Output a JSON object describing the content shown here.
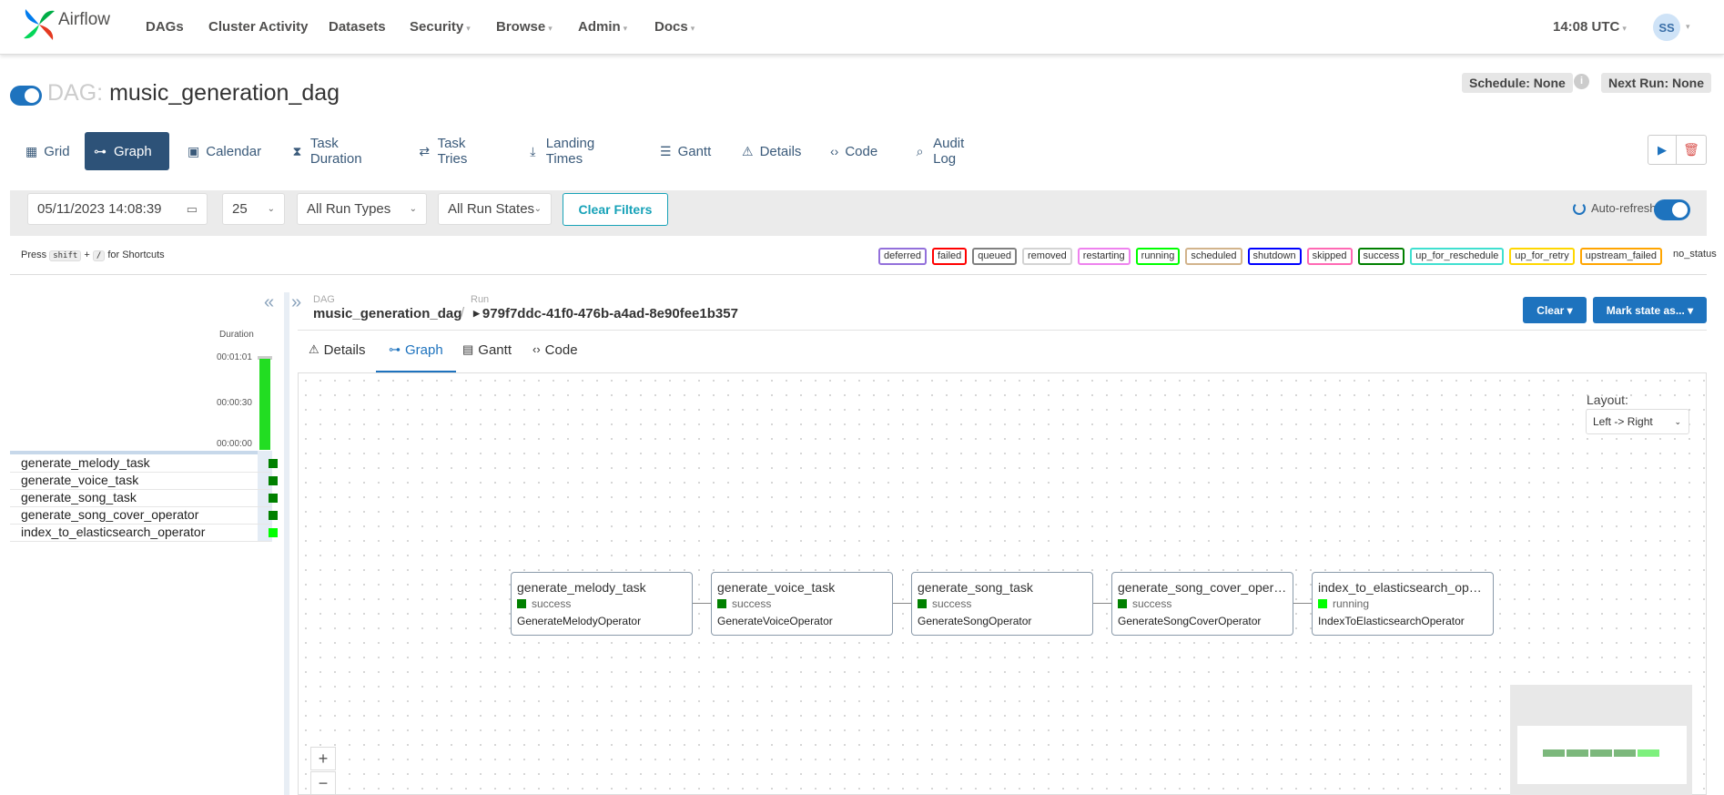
{
  "brand": {
    "name": "Airflow"
  },
  "nav": {
    "items": [
      {
        "label": "DAGs",
        "caret": false
      },
      {
        "label": "Cluster Activity",
        "caret": false
      },
      {
        "label": "Datasets",
        "caret": false
      },
      {
        "label": "Security",
        "caret": true
      },
      {
        "label": "Browse",
        "caret": true
      },
      {
        "label": "Admin",
        "caret": true
      },
      {
        "label": "Docs",
        "caret": true
      }
    ],
    "clock": "14:08 UTC",
    "avatar": "SS"
  },
  "dag": {
    "label": "DAG:",
    "name": "music_generation_dag",
    "schedule": "Schedule: None",
    "next_run": "Next Run: None",
    "paused": false
  },
  "tabs": [
    {
      "label": "Grid",
      "icon": "grid-icon",
      "glyph": "▦",
      "active": false
    },
    {
      "label": "Graph",
      "icon": "graph-icon",
      "glyph": "⊶",
      "active": true
    },
    {
      "label": "Calendar",
      "icon": "calendar-icon",
      "glyph": "▣",
      "active": false
    },
    {
      "label": "Task Duration",
      "icon": "hourglass-icon",
      "glyph": "⧗",
      "active": false
    },
    {
      "label": "Task Tries",
      "icon": "retry-icon",
      "glyph": "⇄",
      "active": false
    },
    {
      "label": "Landing Times",
      "icon": "landing-icon",
      "glyph": "⤓",
      "active": false
    },
    {
      "label": "Gantt",
      "icon": "gantt-icon",
      "glyph": "☰",
      "active": false
    },
    {
      "label": "Details",
      "icon": "warning-icon",
      "glyph": "⚠",
      "active": false
    },
    {
      "label": "Code",
      "icon": "code-icon",
      "glyph": "‹›",
      "active": false
    },
    {
      "label": "Audit Log",
      "icon": "audit-log-icon",
      "glyph": "⌕",
      "active": false
    }
  ],
  "filters": {
    "date": "05/11/2023 14:08:39",
    "num_runs": "25",
    "run_type": "All Run Types",
    "run_state": "All Run States",
    "clear_label": "Clear Filters",
    "auto_refresh_label": "Auto-refresh",
    "auto_refresh_on": true
  },
  "shortcuts": {
    "press": "Press",
    "key1": "shift",
    "plus": "+",
    "key2": "/",
    "suffix": "for Shortcuts"
  },
  "legend": [
    {
      "label": "deferred",
      "color": "#9370db"
    },
    {
      "label": "failed",
      "color": "#ff0000"
    },
    {
      "label": "queued",
      "color": "#808080"
    },
    {
      "label": "removed",
      "color": "#d3d3d3"
    },
    {
      "label": "restarting",
      "color": "#ee82ee"
    },
    {
      "label": "running",
      "color": "#00ff00"
    },
    {
      "label": "scheduled",
      "color": "#d2b48c"
    },
    {
      "label": "shutdown",
      "color": "#0000ff"
    },
    {
      "label": "skipped",
      "color": "#ff69b4"
    },
    {
      "label": "success",
      "color": "#008000"
    },
    {
      "label": "up_for_reschedule",
      "color": "#40e0d0"
    },
    {
      "label": "up_for_retry",
      "color": "#ffd700"
    },
    {
      "label": "upstream_failed",
      "color": "#ffa500"
    },
    {
      "label": "no_status",
      "color": ""
    }
  ],
  "grid": {
    "duration_label": "Duration",
    "ticks": [
      "00:01:01",
      "00:00:30",
      "00:00:00"
    ],
    "run_duration_fraction": 1.0,
    "tasks": [
      {
        "name": "generate_melody_task",
        "state": "success"
      },
      {
        "name": "generate_voice_task",
        "state": "success"
      },
      {
        "name": "generate_song_task",
        "state": "success"
      },
      {
        "name": "generate_song_cover_operator",
        "state": "success"
      },
      {
        "name": "index_to_elasticsearch_operator",
        "state": "running"
      }
    ]
  },
  "breadcrumb": {
    "dag_label": "DAG",
    "dag_name": "music_generation_dag",
    "run_label": "Run",
    "run_id": "979f7ddc-41f0-476b-a4ad-8e90fee1b357"
  },
  "actions": {
    "clear": "Clear",
    "mark_state": "Mark state as..."
  },
  "subtabs": [
    {
      "label": "Details",
      "glyph": "⚠",
      "icon": "warning-icon",
      "active": false
    },
    {
      "label": "Graph",
      "glyph": "⊶",
      "icon": "graph-icon",
      "active": true
    },
    {
      "label": "Gantt",
      "glyph": "▤",
      "icon": "gantt-icon",
      "active": false
    },
    {
      "label": "Code",
      "glyph": "‹›",
      "icon": "code-icon",
      "active": false
    }
  ],
  "graph": {
    "layout_label": "Layout:",
    "layout_value": "Left -> Right",
    "nodes": [
      {
        "name": "generate_melody_task",
        "state": "success",
        "operator": "GenerateMelodyOperator"
      },
      {
        "name": "generate_voice_task",
        "state": "success",
        "operator": "GenerateVoiceOperator"
      },
      {
        "name": "generate_song_task",
        "state": "success",
        "operator": "GenerateSongOperator"
      },
      {
        "name": "generate_song_cover_operator",
        "state": "success",
        "operator": "GenerateSongCoverOperator"
      },
      {
        "name": "index_to_elasticsearch_operator",
        "state": "running",
        "operator": "IndexToElasticsearchOperator"
      }
    ],
    "zoom_in": "+",
    "zoom_out": "−"
  },
  "colors": {
    "success": "#008000",
    "running": "#00ff00",
    "primary": "#1e73be",
    "minimap_success": "#7cb87c",
    "minimap_running": "#7ef07e"
  }
}
